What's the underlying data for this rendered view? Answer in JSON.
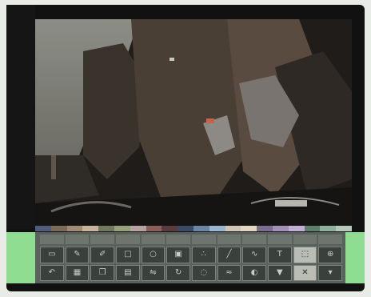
{
  "menu": [
    "",
    "",
    "",
    "",
    "",
    "",
    "",
    "",
    "",
    "",
    "",
    ""
  ],
  "tools": [
    {
      "icon": "eraser-icon"
    },
    {
      "icon": "brush-icon"
    },
    {
      "icon": "pen-icon"
    },
    {
      "icon": "square-icon"
    },
    {
      "icon": "circle-icon"
    },
    {
      "icon": "fill-icon"
    },
    {
      "icon": "spray-icon"
    },
    {
      "icon": "line-icon"
    },
    {
      "icon": "curve-icon"
    },
    {
      "icon": "text-icon"
    },
    {
      "icon": "select-icon"
    },
    {
      "icon": "zoom-icon"
    },
    {
      "icon": "undo-icon"
    },
    {
      "icon": "grid-icon"
    },
    {
      "icon": "copy-icon"
    },
    {
      "icon": "paste-icon"
    },
    {
      "icon": "flip-icon"
    },
    {
      "icon": "rotate-icon"
    },
    {
      "icon": "blur-icon"
    },
    {
      "icon": "smear-icon"
    },
    {
      "icon": "tint-icon"
    },
    {
      "icon": "stamp-icon"
    },
    {
      "icon": "clear-icon"
    },
    {
      "icon": "save-icon"
    }
  ],
  "palette": [
    "#4f5d7a",
    "#7d6b5a",
    "#a08a72",
    "#c8b49a",
    "#6f7a5e",
    "#95a07c",
    "#b7a3a0",
    "#8c5e5a",
    "#5a3a3a",
    "#3b4a63",
    "#6a85a6",
    "#9ab5cf",
    "#d0c6b6",
    "#e3d7c2",
    "#7a6d90",
    "#a38fb8",
    "#c2b0d4",
    "#5f7f6e",
    "#8fb09c",
    "#b5c9b8"
  ]
}
